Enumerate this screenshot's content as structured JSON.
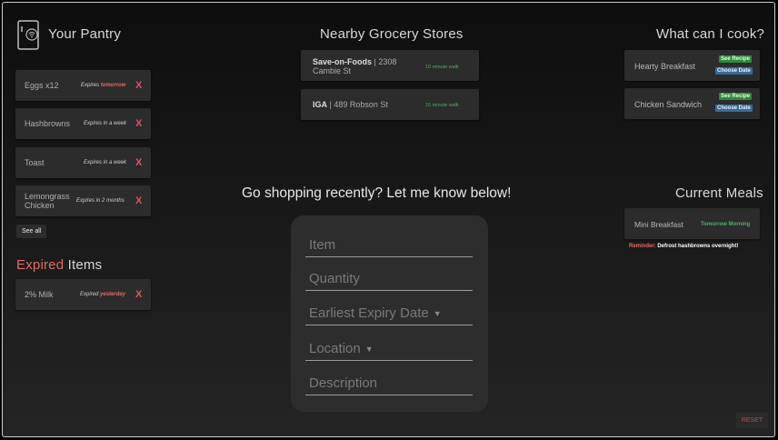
{
  "pantry": {
    "title": "Your Pantry",
    "items": [
      {
        "name": "Eggs x12",
        "expires_prefix": "Expires ",
        "expires_highlight": "tomorrow",
        "x": "X"
      },
      {
        "name": "Hashbrowns",
        "expires_prefix": "Expires in a week",
        "expires_highlight": "",
        "x": "X"
      },
      {
        "name": "Toast",
        "expires_prefix": "Expires in a week",
        "expires_highlight": "",
        "x": "X"
      },
      {
        "name": "Lemongrass Chicken",
        "expires_prefix": "Expires in 2 months",
        "expires_highlight": "",
        "x": "X"
      }
    ],
    "see_all": "See all"
  },
  "expired": {
    "title_red": "Expired",
    "title_rest": " Items",
    "items": [
      {
        "name": "2% Milk",
        "expires_prefix": "Expired ",
        "expires_highlight": "yesterday",
        "x": "X"
      }
    ]
  },
  "stores": {
    "title": "Nearby Grocery Stores",
    "items": [
      {
        "name": "Save-on-Foods",
        "address": " | 2308 Cambie St",
        "walk": "10 minute walk"
      },
      {
        "name": "IGA",
        "address": " | 489 Robson St",
        "walk": "15 minute walk"
      }
    ]
  },
  "cook": {
    "title": "What can I cook?",
    "items": [
      {
        "name": "Hearty Breakfast",
        "see_recipe": "See Recipe",
        "choose_date": "Choose Date"
      },
      {
        "name": "Chicken Sandwich",
        "see_recipe": "See Recipe",
        "choose_date": "Choose Date"
      }
    ]
  },
  "meals": {
    "title": "Current Meals",
    "items": [
      {
        "name": "Mini Breakfast",
        "when": "Tomorrow Morning"
      }
    ],
    "reminder_label": "Reminder:",
    "reminder_text": " Defrost hashbrowns overnight!"
  },
  "form": {
    "prompt": "Go shopping recently? Let me know below!",
    "item_placeholder": "Item",
    "quantity_placeholder": "Quantity",
    "expiry_label": "Earliest Expiry Date",
    "location_label": "Location",
    "description_placeholder": "Description"
  },
  "reset_label": "RESET",
  "colors": {
    "accent_red": "#e26a6a",
    "walk_green": "#4fb05a",
    "tag_green": "#2f8a3a",
    "tag_blue": "#3a6a96"
  },
  "icons": {
    "pantry": "fridge-icon",
    "caret": "caret-down-icon"
  }
}
